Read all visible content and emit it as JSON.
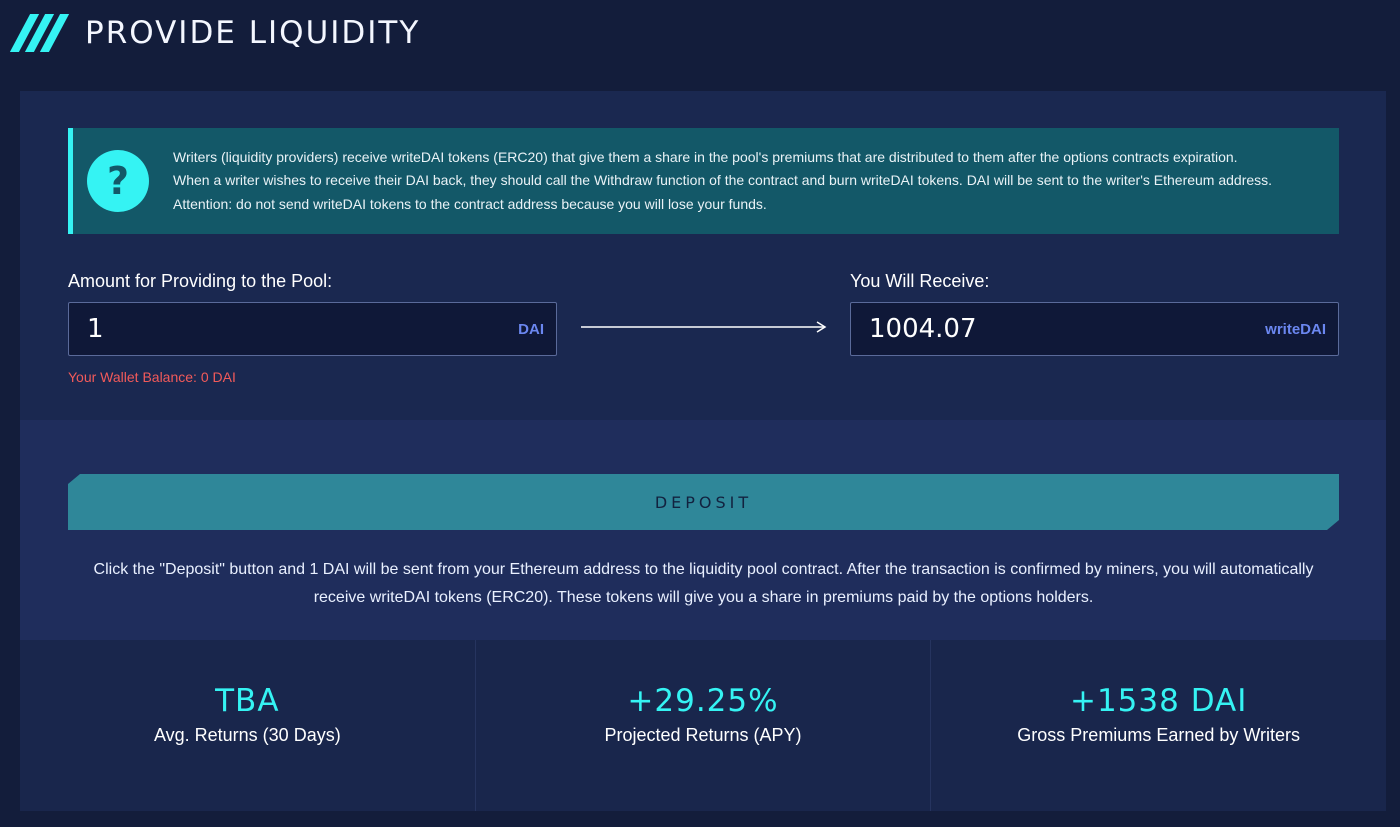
{
  "header": {
    "title": "PROVIDE LIQUIDITY"
  },
  "info": {
    "icon": "question-icon",
    "text": "Writers (liquidity providers) receive writeDAI tokens (ERC20) that give them a share in the pool's premiums that are distributed to them after the options contracts expiration. When a writer wishes to receive their DAI back, they should call the Withdraw function of the contract and burn writeDAI tokens. DAI will be sent to the writer's Ethereum address. Attention: do not send writeDAI tokens to the contract address because you will lose your funds."
  },
  "provide": {
    "label": "Amount for Providing to the Pool:",
    "value": "1",
    "unit": "DAI",
    "wallet_balance": "Your Wallet Balance: 0 DAI"
  },
  "receive": {
    "label": "You Will Receive:",
    "value": "1004.07",
    "unit": "writeDAI"
  },
  "deposit": {
    "button_label": "DEPOSIT",
    "note": "Click the \"Deposit\" button and 1 DAI will be sent from your Ethereum address to the liquidity pool contract. After the transaction is confirmed by miners, you will automatically receive writeDAI tokens (ERC20). These tokens will give you a share in premiums paid by the options holders."
  },
  "stats": [
    {
      "value": "TBA",
      "label": "Avg. Returns (30 Days)"
    },
    {
      "value": "+29.25%",
      "label": "Projected Returns (APY)"
    },
    {
      "value": "+1538 DAI",
      "label": "Gross Premiums Earned by Writers"
    }
  ],
  "colors": {
    "accent": "#35f3f3",
    "background": "#131d3b",
    "info_bg": "#135868",
    "button_bg": "#2f8799",
    "error": "#f25a5a",
    "unit": "#6b87f0"
  }
}
